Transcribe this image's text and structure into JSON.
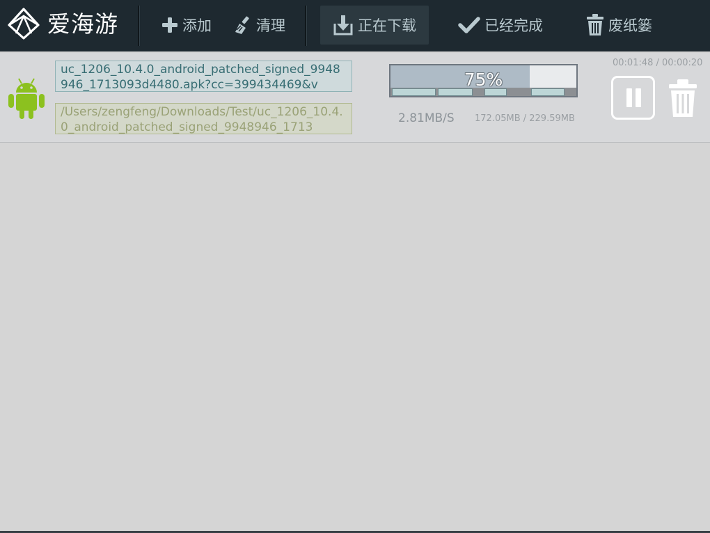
{
  "app": {
    "title": "爱海游",
    "logo_icon": "diamond-logo-icon"
  },
  "toolbar": {
    "add_label": "添加",
    "add_icon": "plus-icon",
    "clean_label": "清理",
    "clean_icon": "brush-icon",
    "downloading_label": "正在下载",
    "downloading_icon": "download-icon",
    "completed_label": "已经完成",
    "completed_icon": "checkmark-icon",
    "trash_label": "废纸篓",
    "trash_icon": "trash-icon",
    "active_tab": "正在下载"
  },
  "download": {
    "file_icon": "android-icon",
    "url": "uc_1206_10.4.0_android_patched_signed_9948946_1713093d4480.apk?cc=399434469&v",
    "path": "/Users/zengfeng/Downloads/Test/uc_1206_10.4.0_android_patched_signed_9948946_1713",
    "progress": 0.75,
    "progress_label": "75%",
    "speed": "2.81MB/S",
    "size": "172.05MB / 229.59MB",
    "time": "00:01:48 / 00:00:20",
    "pause_icon": "pause-icon",
    "delete_icon": "trash-icon"
  },
  "colors": {
    "toolbar_bg": "#1e2930",
    "content_bg": "#d5d5d5",
    "toolbar_text": "#b9c9cf",
    "progress_fill": "#aebbc6",
    "android_green": "#8cc11f"
  }
}
